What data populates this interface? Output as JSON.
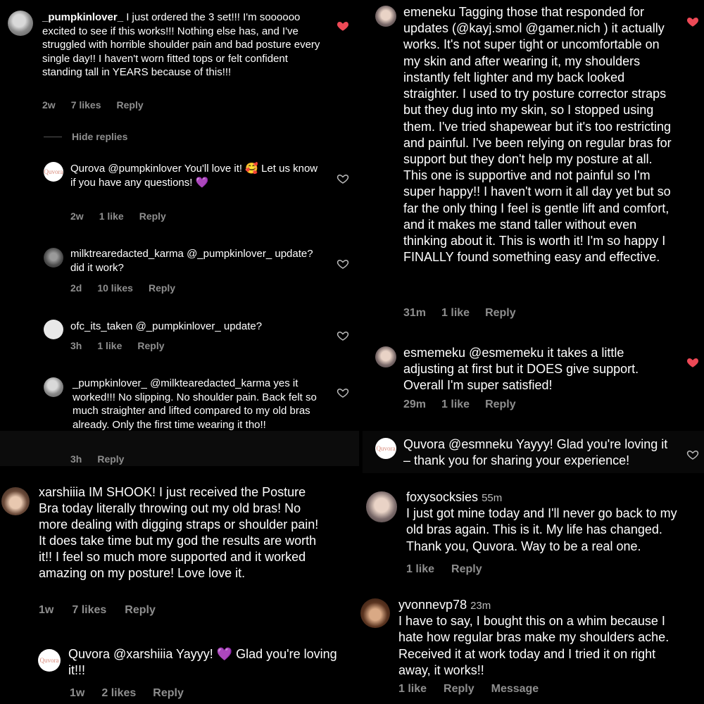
{
  "colors": {
    "heart_liked": "#ed4956",
    "meta_gray": "#8e8e8e",
    "emoji_heart": "#a98bd8"
  },
  "left": {
    "c1": {
      "user": "_pumpkinlover_",
      "text": "I just ordered the 3 set!!! I'm soooooo excited to see if this works!!! Nothing else has, and I've struggled with horrible shoulder pain and bad posture every single day!! I haven't worn fitted tops or felt confident standing tall in YEARS because of this!!!",
      "time": "2w",
      "likes": "7 likes",
      "reply": "Reply"
    },
    "hide_replies": "Hide replies",
    "r1": {
      "avatar_text": "Quvora",
      "user": "Qurova",
      "text": "@pumpkinlover You'll love it! 🥰 Let us know if you have any questions! 💜",
      "time": "2w",
      "likes": "1 like",
      "reply": "Reply"
    },
    "r2": {
      "user": "milktrearedacted_karma",
      "text": "@_pumpkinlover_ update? did it work?",
      "time": "2d",
      "likes": "10 likes",
      "reply": "Reply"
    },
    "r3": {
      "user": "ofc_its_taken",
      "text": "@_pumpkinlover_ update?",
      "time": "3h",
      "likes": "1 like",
      "reply": "Reply"
    },
    "r4": {
      "user": "_pumpkinlover_",
      "text": "@milktearedacted_karma yes it worked!!! No slipping. No shoulder pain. Back felt so much straighter and lifted compared to my old bras already. Only the first time wearing it tho!!",
      "time": "3h",
      "reply": "Reply"
    },
    "c2": {
      "user": "xarshiiia",
      "text": "IM SHOOK! I just received the Posture Bra today literally throwing out my old bras! No more dealing with digging straps or shoulder pain! It does take time but my god the results are worth it!! I feel so much more supported and it worked amazing on my posture! Love love it.",
      "time": "1w",
      "likes": "7 likes",
      "reply": "Reply"
    },
    "r5": {
      "avatar_text": "Quvora",
      "user": "Quvora",
      "text": "@xarshiiia Yayyy! 💜 Glad you're loving it!!!",
      "time": "1w",
      "likes": "2 likes",
      "reply": "Reply"
    }
  },
  "right": {
    "c1": {
      "user": "emeneku",
      "text": "Tagging those that responded for updates (@kayj.smol @gamer.nich ) it actually works. It's not super tight or uncomfortable on my skin and after wearing it, my shoulders instantly felt lighter and my back looked straighter. I used to try posture corrector straps but they dug into my skin, so I stopped using them. I've tried shapewear but it's too restricting and painful. I've been relying on regular bras for support but they don't help my posture at all. This one is supportive and not painful so I'm super happy!! I haven't worn it all day yet but so far the only thing I feel is gentle lift and comfort, and it makes me stand taller without even thinking about it. This is worth it! I'm so happy I FINALLY found something easy and effective.",
      "time": "31m",
      "likes": "1 like",
      "reply": "Reply"
    },
    "c2": {
      "user": "esmemeku",
      "text": "@esmemeku it takes a little adjusting at first but it DOES give support. Overall I'm super satisfied!",
      "time": "29m",
      "likes": "1 like",
      "reply": "Reply"
    },
    "r1": {
      "avatar_text": "Quvora",
      "user": "Quvora",
      "text": "@esmneku Yayyy! Glad you're loving it – thank you for sharing your experience!"
    },
    "c3": {
      "user": "foxysocksies",
      "time_inline": "55m",
      "text": "I just got mine today and I'll never go back to my old bras again. This is it. My life has changed. Thank you, Quvora. Way to be a real one.",
      "likes": "1 like",
      "reply": "Reply"
    },
    "c4": {
      "user": "yvonnevp78",
      "time_inline": "23m",
      "text": "I have to say, I bought this on a whim because I hate how regular bras make my shoulders ache. Received it at work today and I tried it on right away, it works!!",
      "likes": "1 like",
      "reply": "Reply",
      "message": "Message"
    }
  }
}
